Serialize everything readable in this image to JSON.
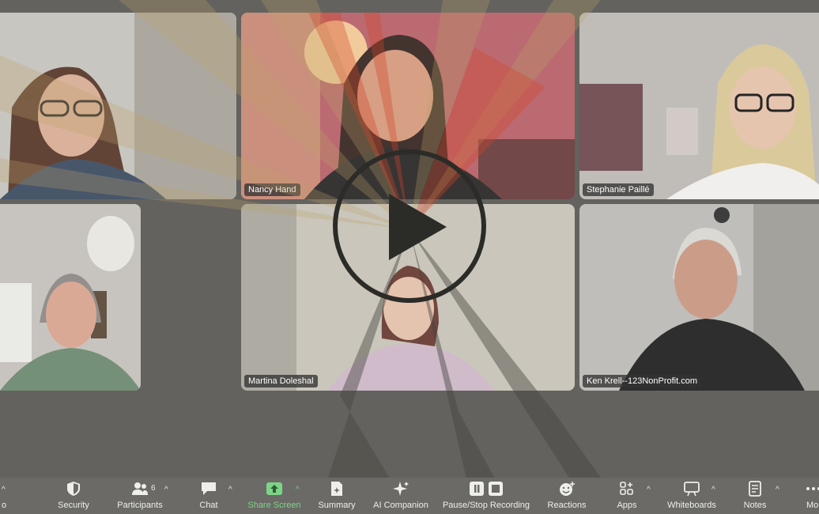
{
  "participants": [
    {
      "id": "p1",
      "name": ""
    },
    {
      "id": "p2",
      "name": "Nancy Hand"
    },
    {
      "id": "p3",
      "name": "Stephanie Paillé"
    },
    {
      "id": "p4",
      "name": ""
    },
    {
      "id": "p5",
      "name": "Martina Doleshal"
    },
    {
      "id": "p6",
      "name": "Ken Krell--123NonProfit.com"
    }
  ],
  "toolbar": {
    "items": [
      {
        "label": "o",
        "icon": "audio-icon"
      },
      {
        "label": "Security",
        "icon": "shield-icon"
      },
      {
        "label": "Participants",
        "icon": "participants-icon",
        "count": "6"
      },
      {
        "label": "Chat",
        "icon": "chat-icon"
      },
      {
        "label": "Share Screen",
        "icon": "share-screen-icon",
        "color": "#7dd487"
      },
      {
        "label": "Summary",
        "icon": "summary-icon"
      },
      {
        "label": "AI Companion",
        "icon": "sparkle-icon"
      },
      {
        "label": "Pause/Stop Recording",
        "icon": "pause-stop-icon"
      },
      {
        "label": "Reactions",
        "icon": "reaction-icon"
      },
      {
        "label": "Apps",
        "icon": "apps-icon"
      },
      {
        "label": "Whiteboards",
        "icon": "whiteboard-icon"
      },
      {
        "label": "Notes",
        "icon": "notes-icon"
      },
      {
        "label": "Mo",
        "icon": "more-icon"
      }
    ],
    "caret": "^"
  },
  "overlay": {
    "icon": "play-button-icon"
  },
  "colors": {
    "active_border": "#9bd27a",
    "toolbar_bg": "#6b6a66",
    "share_green": "#7dd487"
  }
}
